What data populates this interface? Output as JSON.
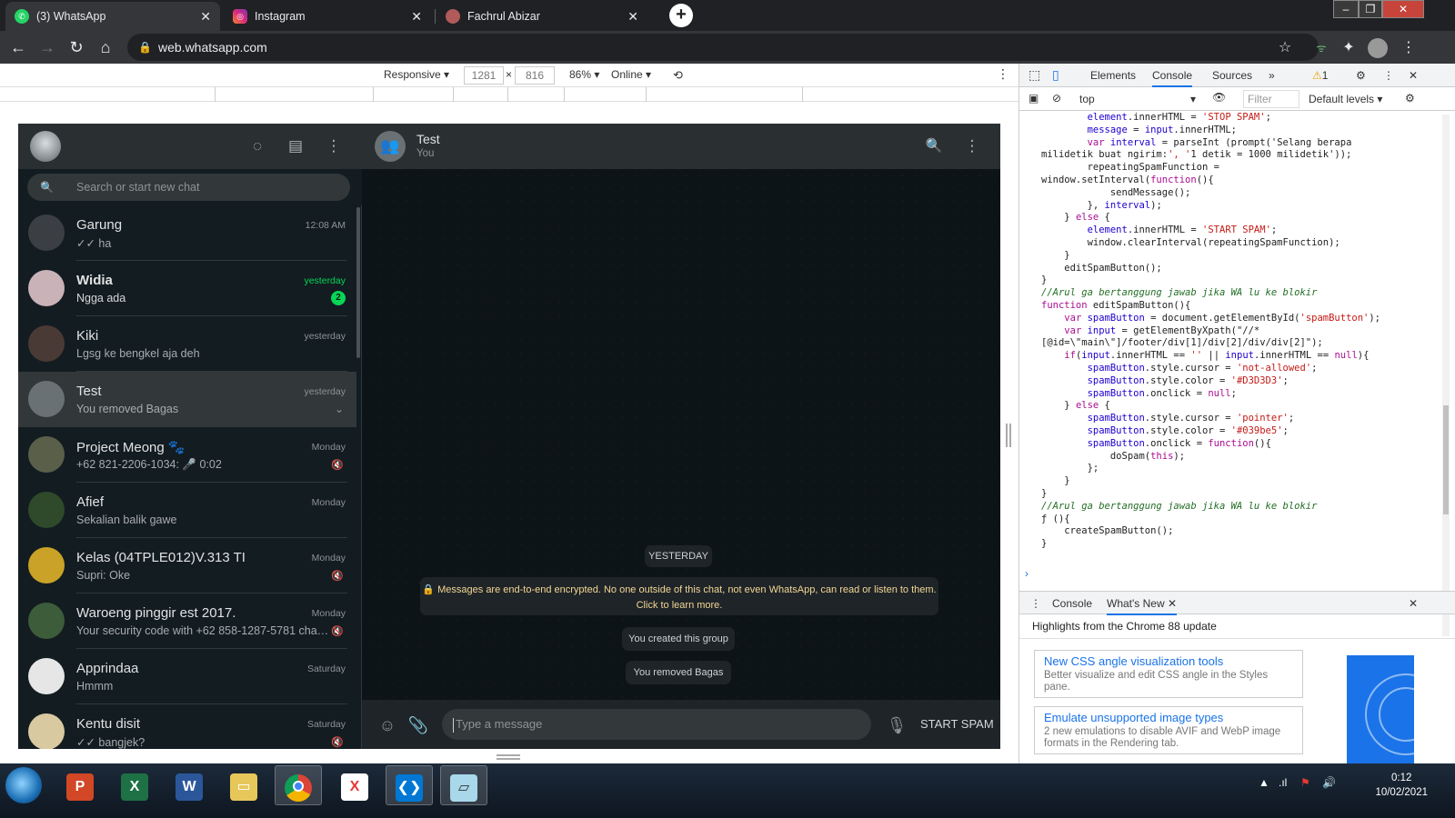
{
  "browser": {
    "tabs": [
      {
        "title": "(3) WhatsApp",
        "icon": "whatsapp-icon",
        "active": true
      },
      {
        "title": "Instagram",
        "icon": "instagram-icon",
        "active": false
      },
      {
        "title": "Fachrul Abizar",
        "icon": "profile-icon",
        "active": false
      }
    ],
    "url": "web.whatsapp.com"
  },
  "device_toolbar": {
    "mode": "Responsive",
    "width": "1281",
    "height": "816",
    "zoom": "86%",
    "network": "Online"
  },
  "whatsapp": {
    "search_placeholder": "Search or start new chat",
    "chats": [
      {
        "name": "Garung",
        "time": "12:08 AM",
        "message": "✓✓ ha",
        "avatar_color": "#3b3f44"
      },
      {
        "name": "Widia",
        "time": "yesterday",
        "message": "Ngga ada",
        "unread": "2",
        "avatar_color": "#c9b3b8"
      },
      {
        "name": "Kiki",
        "time": "yesterday",
        "message": "Lgsg ke bengkel aja deh",
        "avatar_color": "#4a3a36"
      },
      {
        "name": "Test",
        "time": "yesterday",
        "message": "You removed Bagas",
        "avatar_color": "#6a7175"
      },
      {
        "name": "Project Meong 🐾",
        "time": "Monday",
        "message": "+62 821-2206-1034: 🎤 0:02",
        "avatar_color": "#5a5f4a"
      },
      {
        "name": "Afief",
        "time": "Monday",
        "message": "Sekalian balik gawe",
        "avatar_color": "#2e4a2a"
      },
      {
        "name": "Kelas (04TPLE012)V.313 TI",
        "time": "Monday",
        "message": "Supri: Oke",
        "avatar_color": "#c9a227"
      },
      {
        "name": "Waroeng pinggir est 2017.",
        "time": "Monday",
        "message": "Your security code with +62 858-1287-5781 chang...",
        "avatar_color": "#3c5c3a"
      },
      {
        "name": "Apprindaa",
        "time": "Saturday",
        "message": "Hmmm",
        "avatar_color": "#e6e6e6"
      },
      {
        "name": "Kentu disit",
        "time": "Saturday",
        "message": "✓✓ bangjek?",
        "avatar_color": "#d9c9a0"
      }
    ],
    "conversation": {
      "title": "Test",
      "subtitle": "You",
      "date_chip": "YESTERDAY",
      "encryption_line1": "🔒 Messages are end-to-end encrypted. No one outside of this chat, not even WhatsApp, can read or listen to them.",
      "encryption_line2": "Click to learn more.",
      "system_messages": [
        "You created this group",
        "You removed Bagas"
      ],
      "input_placeholder": "Type a message",
      "spam_button": "START SPAM"
    }
  },
  "devtools": {
    "tabs": [
      "Elements",
      "Console",
      "Sources"
    ],
    "warning_count": "1",
    "context": "top",
    "filter_placeholder": "Filter",
    "levels": "Default levels",
    "console_lines": [
      "        element.innerHTML = 'STOP SPAM';",
      "        message = input.innerHTML;",
      "        var interval = parseInt (prompt('Selang berapa",
      "milidetik buat ngirim:', '1 detik = 1000 milidetik'));",
      "        repeatingSpamFunction =",
      "window.setInterval(function(){",
      "            sendMessage();",
      "        }, interval);",
      "    } else {",
      "        element.innerHTML = 'START SPAM';",
      "        window.clearInterval(repeatingSpamFunction);",
      "    }",
      "    editSpamButton();",
      "}",
      "//Arul ga bertanggung jawab jika WA lu ke blokir",
      "function editSpamButton(){",
      "    var spamButton = document.getElementById('spamButton');",
      "    var input = getElementByXpath(\"//*",
      "[@id=\\\"main\\\"]/footer/div[1]/div[2]/div/div[2]\");",
      "    if(input.innerHTML == '' || input.innerHTML == null){",
      "        spamButton.style.cursor = 'not-allowed';",
      "        spamButton.style.color = '#D3D3D3';",
      "        spamButton.onclick = null;",
      "    } else {",
      "        spamButton.style.cursor = 'pointer';",
      "        spamButton.style.color = '#039be5';",
      "        spamButton.onclick = function(){",
      "            doSpam(this);",
      "        };",
      "    }",
      "}",
      "//Arul ga bertanggung jawab jika WA lu ke blokir",
      "ƒ (){",
      "    createSpamButton();",
      "}"
    ],
    "drawer": {
      "tabs": [
        "Console",
        "What's New"
      ],
      "title": "Highlights from the Chrome 88 update",
      "items": [
        {
          "title": "New CSS angle visualization tools",
          "desc": "Better visualize and edit CSS angle in the Styles pane."
        },
        {
          "title": "Emulate unsupported image types",
          "desc": "2 new emulations to disable AVIF and WebP image formats in the Rendering tab."
        }
      ]
    }
  },
  "taskbar": {
    "time": "0:12",
    "date": "10/02/2021",
    "apps": [
      "powerpoint-icon",
      "excel-icon",
      "word-icon",
      "explorer-icon",
      "chrome-icon",
      "xampp-icon",
      "vscode-icon",
      "notepad-icon"
    ]
  }
}
